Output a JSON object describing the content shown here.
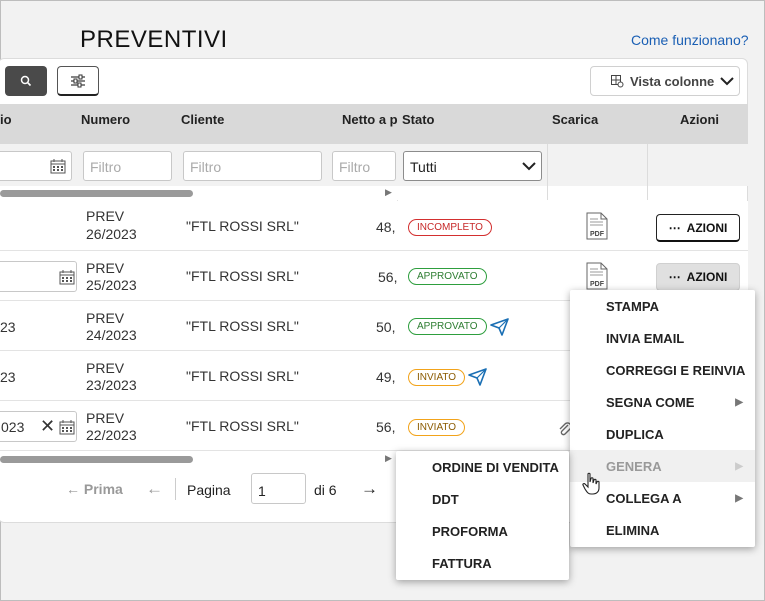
{
  "header": {
    "title": "PREVENTIVI",
    "help_link": "Come funzionano?"
  },
  "toolbar": {
    "columns_view": "Vista colonne"
  },
  "table": {
    "columns": {
      "data": "io",
      "numero": "Numero",
      "cliente": "Cliente",
      "netto": "Netto a p",
      "stato": "Stato",
      "scarica": "Scarica",
      "azioni": "Azioni"
    },
    "filters": {
      "numero_placeholder": "Filtro",
      "cliente_placeholder": "Filtro",
      "netto_placeholder": "Filtro",
      "stato_selected": "Tutti"
    },
    "rows": [
      {
        "date": "",
        "numero_1": "PREV",
        "numero_2": "26/2023",
        "cliente": "\"FTL ROSSI SRL\"",
        "netto": "48,",
        "stato": "INCOMPLETO",
        "azioni": "AZIONI"
      },
      {
        "date": "",
        "numero_1": "PREV",
        "numero_2": "25/2023",
        "cliente": "\"FTL ROSSI SRL\"",
        "netto": "56,",
        "stato": "APPROVATO",
        "azioni": "AZIONI"
      },
      {
        "date": "23",
        "numero_1": "PREV",
        "numero_2": "24/2023",
        "cliente": "\"FTL ROSSI SRL\"",
        "netto": "50,",
        "stato": "APPROVATO"
      },
      {
        "date": "23",
        "numero_1": "PREV",
        "numero_2": "23/2023",
        "cliente": "\"FTL ROSSI SRL\"",
        "netto": "49,",
        "stato": "INVIATO"
      },
      {
        "date": "023",
        "numero_1": "PREV",
        "numero_2": "22/2023",
        "cliente": "\"FTL ROSSI SRL\"",
        "netto": "56,",
        "stato": "INVIATO"
      }
    ]
  },
  "pagination": {
    "first": "Prima",
    "page_label": "Pagina",
    "page_value": "1",
    "of_label": "di 6"
  },
  "actions_menu": {
    "items": [
      "STAMPA",
      "INVIA EMAIL",
      "CORREGGI E REINVIA",
      "SEGNA COME",
      "DUPLICA",
      "GENERA",
      "COLLEGA A",
      "ELIMINA"
    ]
  },
  "genera_submenu": {
    "items": [
      "ORDINE DI VENDITA",
      "DDT",
      "PROFORMA",
      "FATTURA"
    ]
  },
  "colors": {
    "accent_link": "#1a5fb4",
    "red": "#c62828",
    "green": "#2e7d32",
    "orange": "#f2a31a"
  }
}
